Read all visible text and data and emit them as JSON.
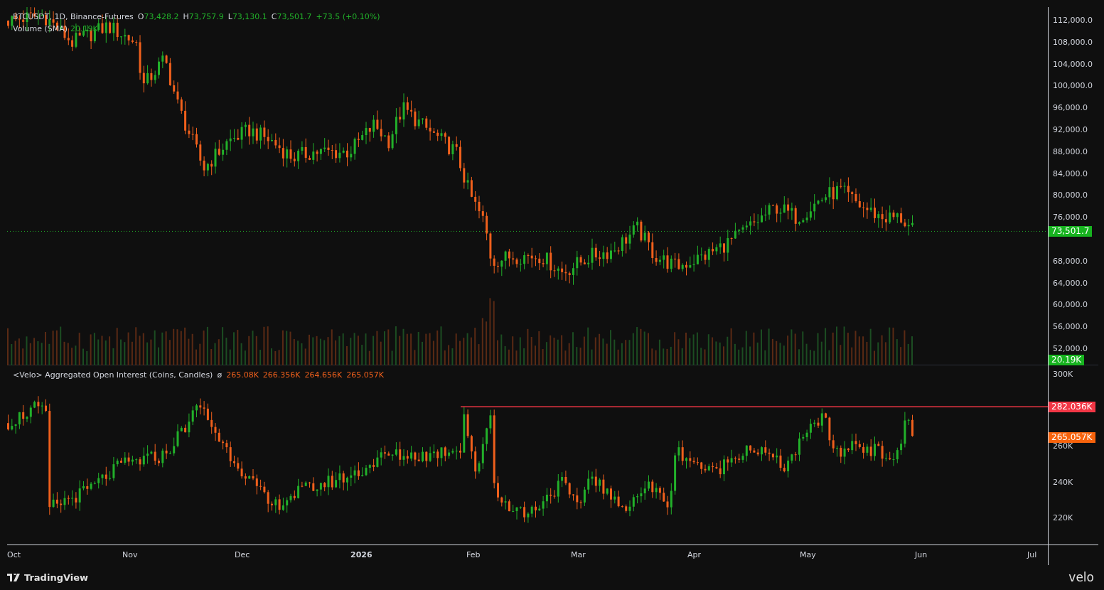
{
  "price_legend": {
    "symbol": "BTCUSDT, 1D, Binance-Futures",
    "ohlc": [
      {
        "label": "O",
        "value": "73,428.2"
      },
      {
        "label": "H",
        "value": "73,757.9"
      },
      {
        "label": "L",
        "value": "73,130.1"
      },
      {
        "label": "C",
        "value": "73,501.7"
      }
    ],
    "change": "+73.5 (+0.10%)"
  },
  "volume_legend": {
    "label": "Volume (SMA)",
    "value": "20.19K"
  },
  "price_axis": [
    "112,000.0",
    "108,000.0",
    "104,000.0",
    "100,000.0",
    "96,000.0",
    "92,000.0",
    "88,000.0",
    "84,000.0",
    "80,000.0",
    "76,000.0",
    "68,000.0",
    "64,000.0",
    "60,000.0",
    "56,000.0",
    "52,000.0"
  ],
  "price_badges": [
    {
      "text": "73,501.7",
      "color": "#17b31f"
    },
    {
      "text": "20.19K",
      "color": "#17b31f"
    }
  ],
  "oi_legend": {
    "label": "<Velo> Aggregated Open Interest (Coins, Candles)",
    "symbol": "ø",
    "values": [
      "265.08K",
      "266.356K",
      "264.656K",
      "265.057K"
    ]
  },
  "oi_axis": [
    "300K",
    "260K",
    "240K",
    "220K"
  ],
  "oi_badges": [
    {
      "text": "282.036K",
      "color": "#f23645"
    },
    {
      "text": "265.057K",
      "color": "#f7630c"
    }
  ],
  "time_axis": [
    "Oct",
    "Nov",
    "Dec",
    "2026",
    "Feb",
    "Mar",
    "Apr",
    "May",
    "Jun",
    "Jul"
  ],
  "footer": {
    "brand": "TradingView",
    "partner": "velo"
  }
}
